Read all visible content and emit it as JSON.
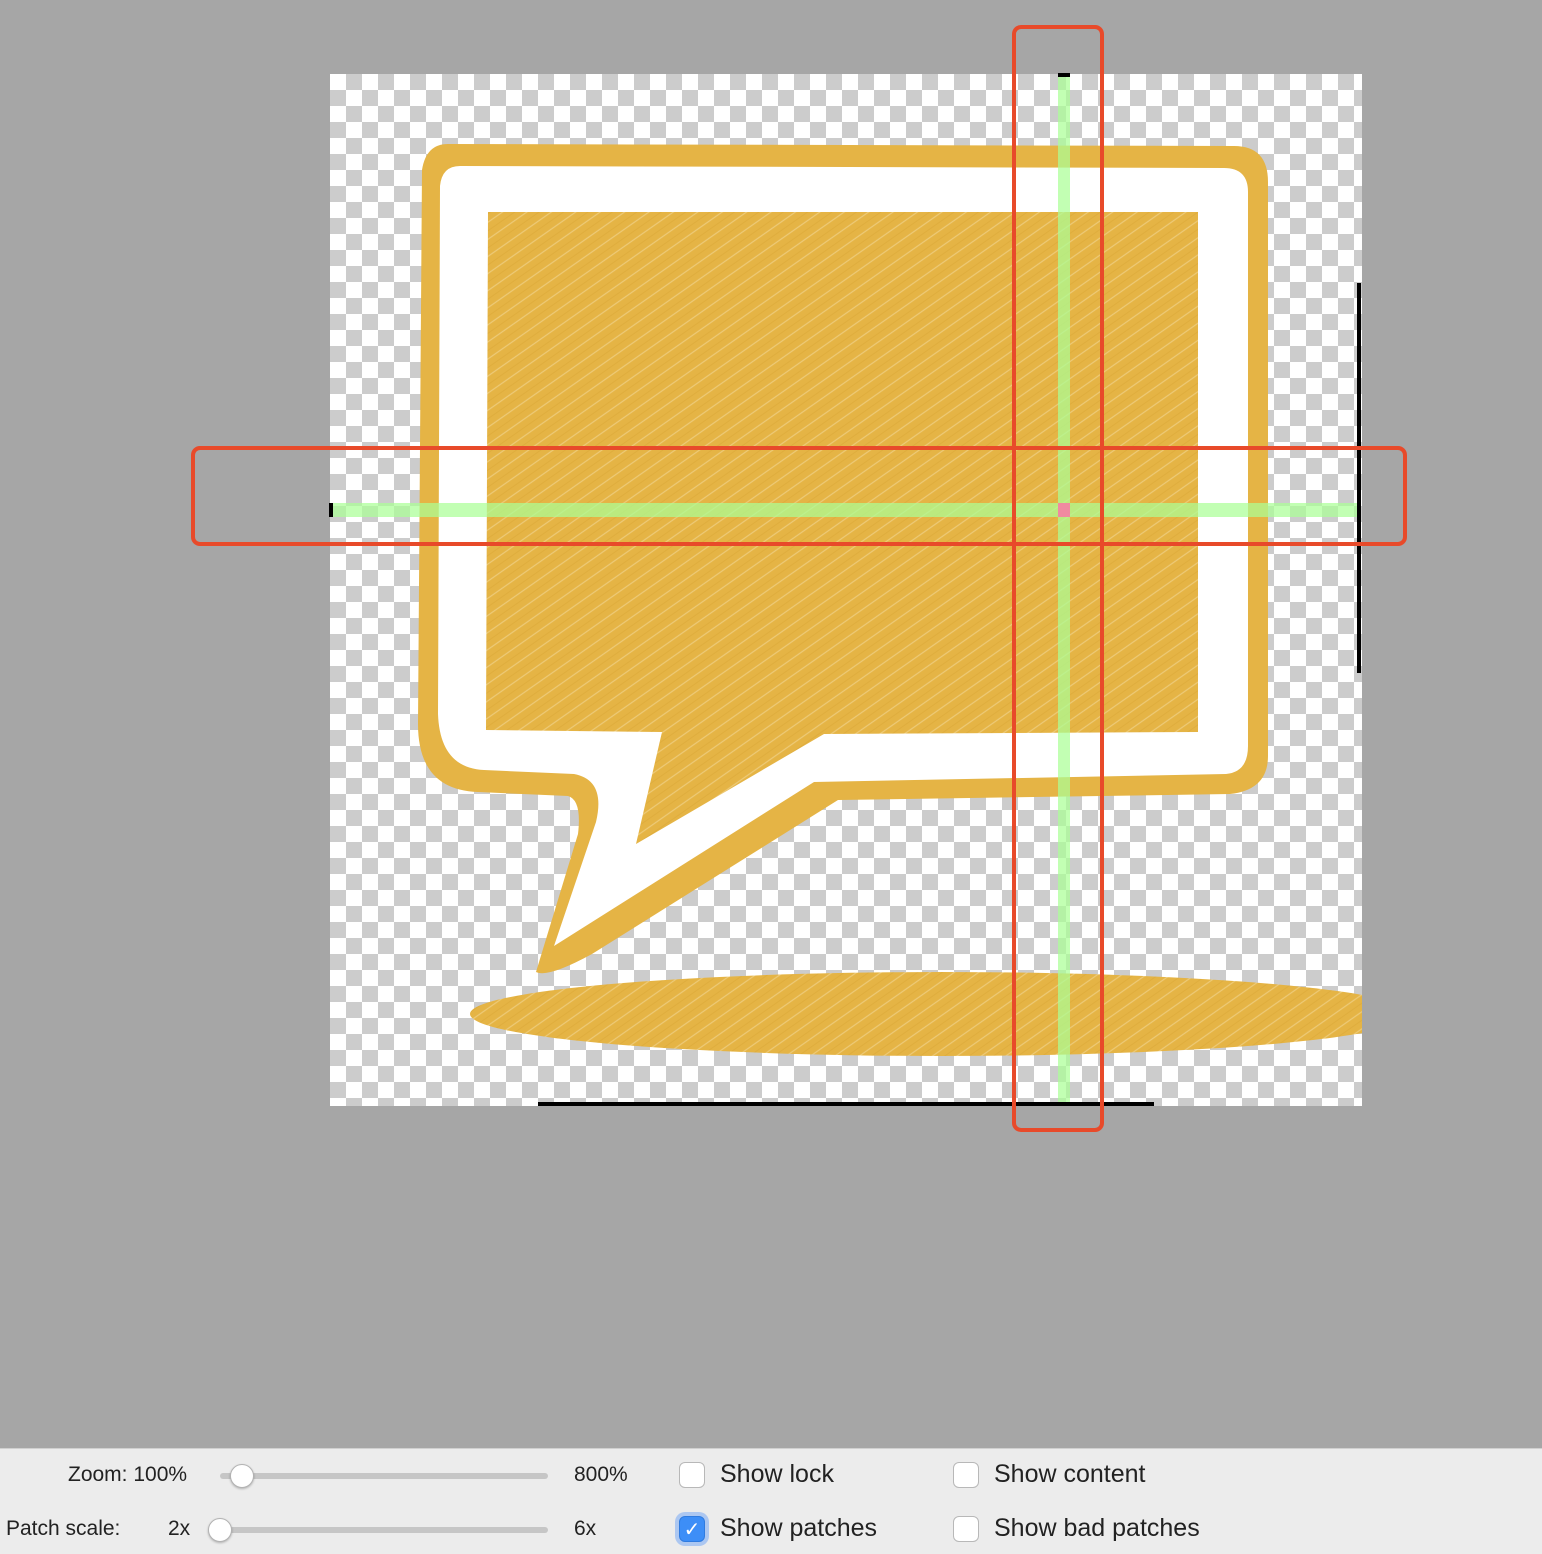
{
  "controls": {
    "zoom": {
      "label": "Zoom: 100%",
      "max_label": "800%",
      "value_percent": 100,
      "min_percent": 100,
      "max_percent": 800
    },
    "patch_scale": {
      "label": "Patch scale:",
      "min_label": "2x",
      "max_label": "6x",
      "value": 2
    },
    "checkboxes": [
      {
        "label": "Show lock",
        "checked": false
      },
      {
        "label": "Show content",
        "checked": false
      },
      {
        "label": "Show patches",
        "checked": true
      },
      {
        "label": "Show bad patches",
        "checked": false
      }
    ],
    "checkmark_glyph": "✓"
  },
  "colors": {
    "canvas_background": "#a6a6a6",
    "artwork_fill": "#e5b445",
    "patch_overlay": "#aaff96",
    "highlight": "#e84a2a",
    "checkbox_accent": "#3d8ef7"
  },
  "artwork": {
    "icon": "speech-bubble-icon"
  }
}
